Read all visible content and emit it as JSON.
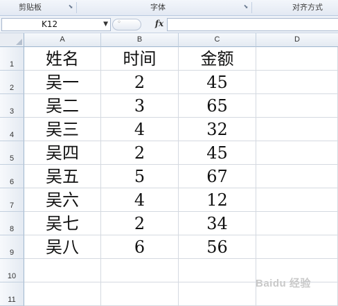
{
  "ribbon": {
    "groups": [
      {
        "label": "剪贴板",
        "launcher": "dialog-launcher-icon"
      },
      {
        "label": "字体",
        "launcher": "dialog-launcher-icon"
      },
      {
        "label": "对齐方式"
      }
    ]
  },
  "formula_bar": {
    "name_box": "K12",
    "fx_label": "fx",
    "formula": ""
  },
  "sheet": {
    "columns": [
      "A",
      "B",
      "C",
      "D"
    ],
    "rows": [
      "1",
      "2",
      "3",
      "4",
      "5",
      "6",
      "7",
      "8",
      "9",
      "10",
      "11"
    ],
    "header": [
      "姓名",
      "时间",
      "金额"
    ],
    "data": [
      [
        "吴一",
        "2",
        "45"
      ],
      [
        "吴二",
        "3",
        "65"
      ],
      [
        "吴三",
        "4",
        "32"
      ],
      [
        "吴四",
        "2",
        "45"
      ],
      [
        "吴五",
        "5",
        "67"
      ],
      [
        "吴六",
        "4",
        "12"
      ],
      [
        "吴七",
        "2",
        "34"
      ],
      [
        "吴八",
        "6",
        "56"
      ]
    ]
  },
  "watermark": "Baidu 经验"
}
